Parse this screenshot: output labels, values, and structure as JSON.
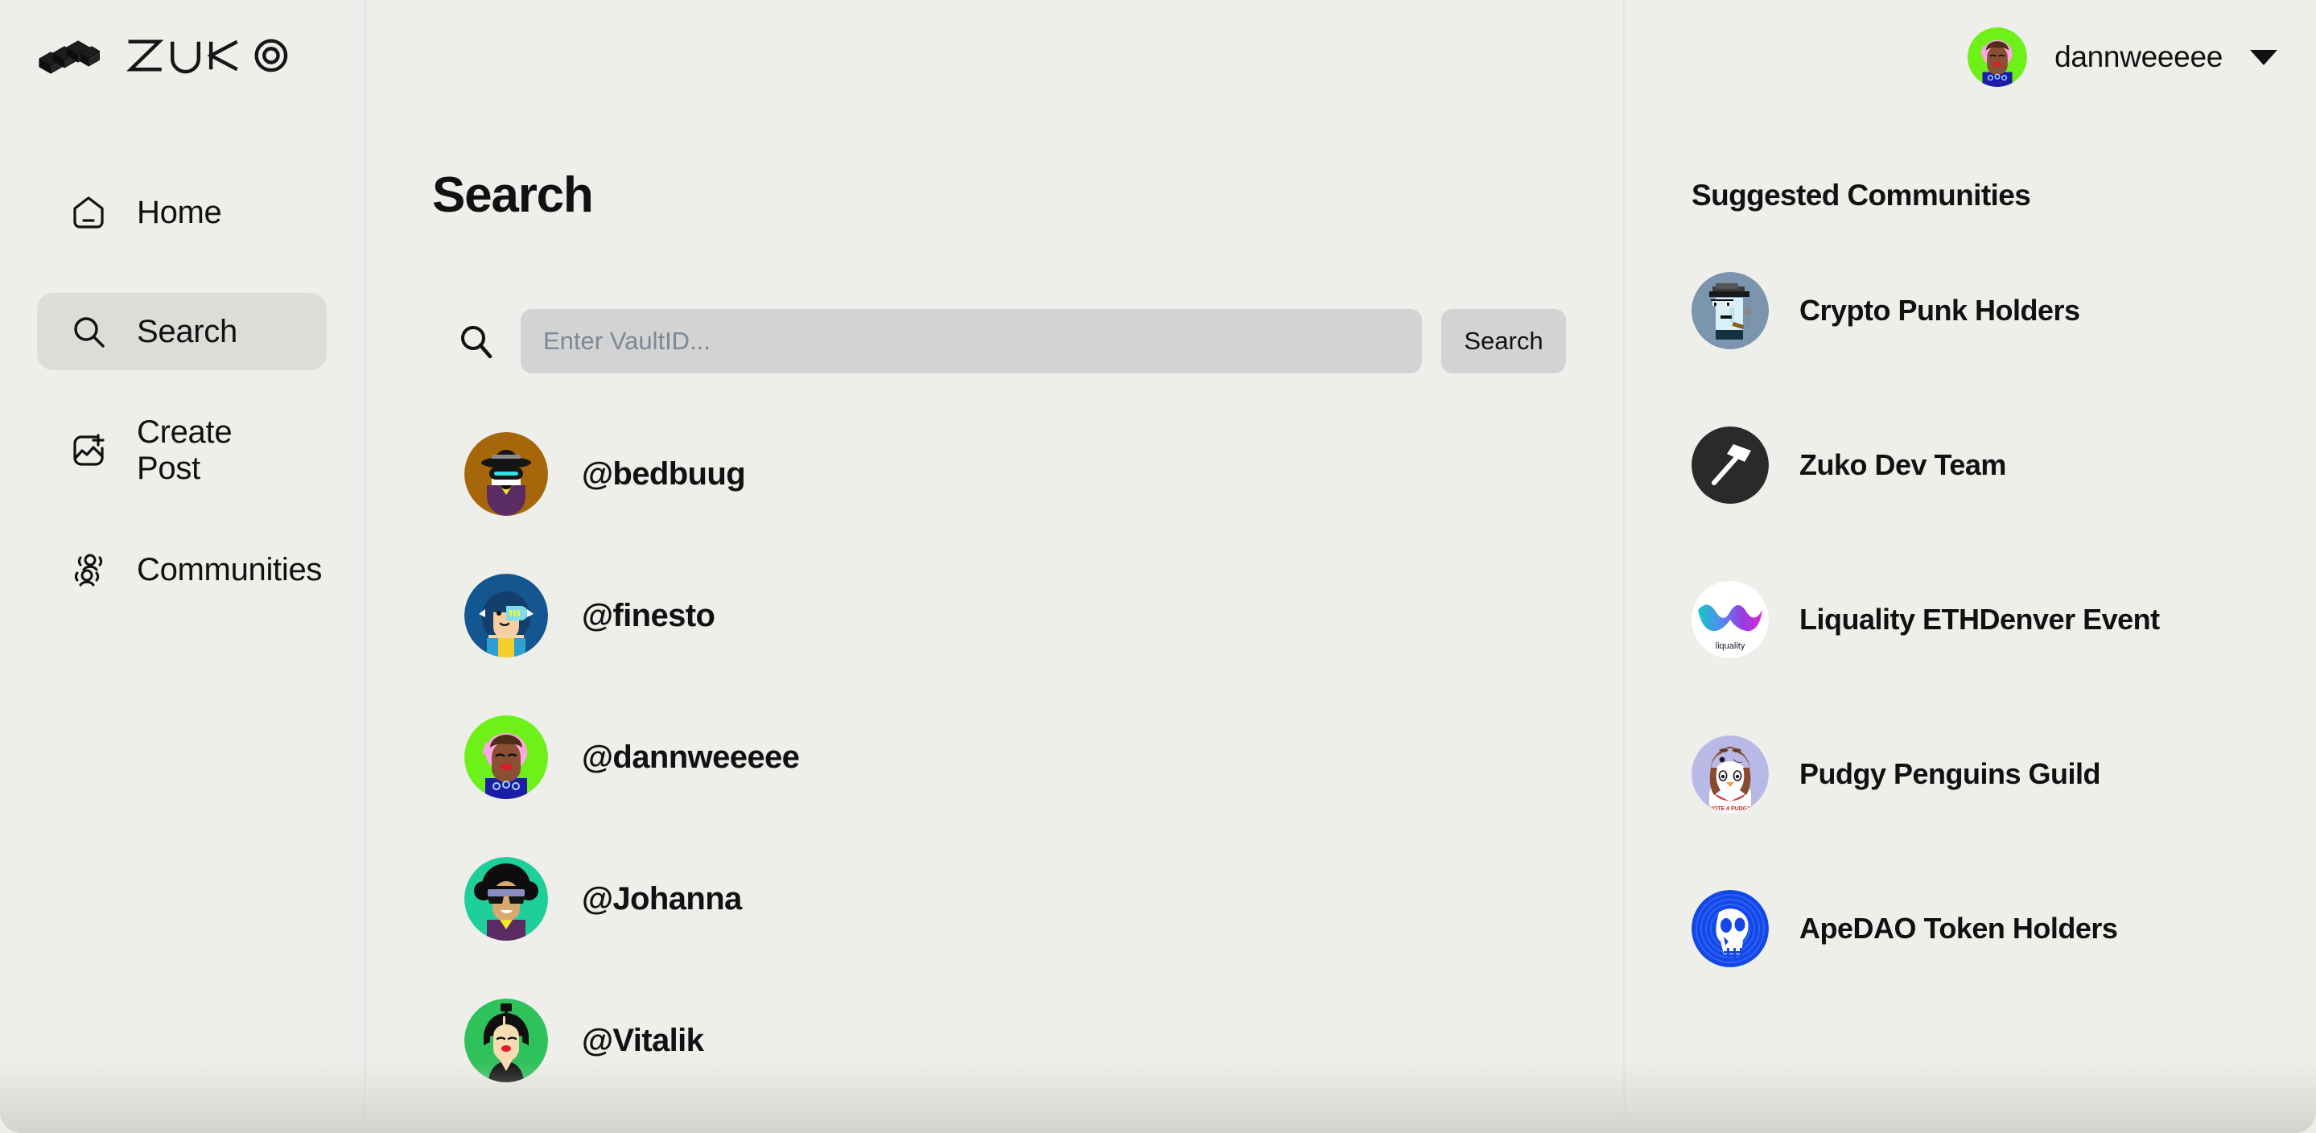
{
  "brand": {
    "name": "ZUKO",
    "logo_icon": "zuko-cubes-logo"
  },
  "sidebar": {
    "items": [
      {
        "label": "Home",
        "icon": "home-icon",
        "active": false
      },
      {
        "label": "Search",
        "icon": "search-icon",
        "active": true
      },
      {
        "label": "Create Post",
        "icon": "create-post-icon",
        "active": false
      },
      {
        "label": "Communities",
        "icon": "communities-icon",
        "active": false
      }
    ]
  },
  "main": {
    "title": "Search",
    "search": {
      "icon": "search-icon",
      "placeholder": "Enter VaultID...",
      "value": "",
      "button_label": "Search"
    },
    "results": [
      {
        "handle": "@bedbuug",
        "avatar": "avatar-bedbuug"
      },
      {
        "handle": "@finesto",
        "avatar": "avatar-finesto"
      },
      {
        "handle": "@dannweeeee",
        "avatar": "avatar-dannweeeee"
      },
      {
        "handle": "@Johanna",
        "avatar": "avatar-johanna"
      },
      {
        "handle": "@Vitalik",
        "avatar": "avatar-vitalik"
      }
    ]
  },
  "right_panel": {
    "title": "Suggested Communities",
    "communities": [
      {
        "name": "Crypto Punk Holders",
        "avatar": "avatar-cryptopunk"
      },
      {
        "name": "Zuko Dev Team",
        "avatar": "avatar-zuko-hammer"
      },
      {
        "name": "Liquality ETHDenver Event",
        "avatar": "avatar-liquality"
      },
      {
        "name": "Pudgy Penguins Guild",
        "avatar": "avatar-pudgy"
      },
      {
        "name": "ApeDAO Token Holders",
        "avatar": "avatar-apedao"
      }
    ]
  },
  "header": {
    "user": {
      "name": "dannweeeee",
      "avatar": "avatar-dannweeeee",
      "caret_icon": "chevron-down-icon"
    }
  },
  "colors": {
    "page_background": "#eeefea",
    "active_nav_background": "#dcdcd9",
    "input_background": "#d3d3d3",
    "divider": "#e1e7ea",
    "text": "#111111",
    "placeholder": "#7b8897"
  }
}
